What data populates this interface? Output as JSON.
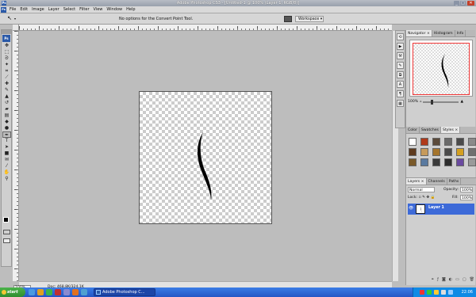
{
  "window": {
    "title": "Adobe Photoshop CS3 - [Untitled-1 @ 100% (Layer 1, RGB/8)]",
    "min": "_",
    "max": "□",
    "close": "✕"
  },
  "menu": {
    "app_badge": "Ps",
    "items": [
      "File",
      "Edit",
      "Image",
      "Layer",
      "Select",
      "Filter",
      "View",
      "Window",
      "Help"
    ]
  },
  "options": {
    "hint": "No options for the Convert Point Tool.",
    "workspace_label": "Workspace ▾"
  },
  "toolbox": {
    "logo": "Ps"
  },
  "status": {
    "zoom": "100%",
    "doc_info": "Doc: 468,8K/324,1K"
  },
  "navigator": {
    "tabs": [
      "Navigator ×",
      "Histogram",
      "Info"
    ],
    "zoom": "100%"
  },
  "color_panel": {
    "tabs": [
      "Color",
      "Swatches",
      "Styles ×"
    ],
    "styles": [
      "#ffffff",
      "#b03a1a",
      "#5b4a3a",
      "#6a6a6a",
      "#4a4a4a",
      "#8a8a8a",
      "#5e3b1e",
      "#c79a5a",
      "#a4742c",
      "#4a4a4a",
      "#d4a020",
      "#707070",
      "#7a5a2a",
      "#5a7aa0",
      "#3a3a3a",
      "#2c2c2c",
      "#6a4aa0",
      "#9a9a9a"
    ]
  },
  "layers": {
    "tabs": [
      "Layers ×",
      "Channels",
      "Paths"
    ],
    "blend_mode": "Normal",
    "opacity_label": "Opacity:",
    "opacity": "100%",
    "lock_label": "Lock:",
    "fill_label": "Fill:",
    "fill": "100%",
    "layer_name": "Layer 1"
  },
  "taskbar": {
    "start": "start",
    "task": "Adobe Photoshop C...",
    "clock": "22:06"
  }
}
